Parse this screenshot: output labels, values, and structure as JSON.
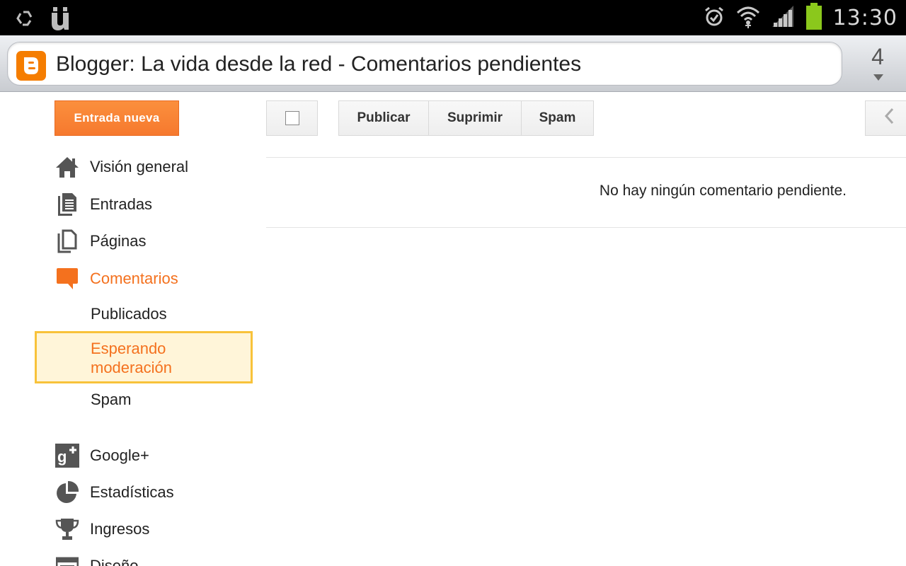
{
  "status_bar": {
    "time": "13:30",
    "icons": [
      "recycle-icon",
      "u-umlaut-app-icon",
      "alarm-icon",
      "wifi-icon",
      "signal-icon",
      "battery-icon"
    ],
    "battery_color": "#8bc81c"
  },
  "browser": {
    "page_title": "Blogger: La vida desde la red - Comentarios pendientes",
    "tab_count": "4",
    "favicon_color": "#f57d00"
  },
  "sidebar": {
    "new_post_label": "Entrada nueva",
    "items": [
      {
        "label": "Visión general",
        "icon": "home-icon"
      },
      {
        "label": "Entradas",
        "icon": "posts-icon"
      },
      {
        "label": "Páginas",
        "icon": "pages-icon"
      },
      {
        "label": "Comentarios",
        "icon": "comment-icon",
        "active": true
      },
      {
        "label": "Google+",
        "icon": "google-plus-icon"
      },
      {
        "label": "Estadísticas",
        "icon": "pie-chart-icon"
      },
      {
        "label": "Ingresos",
        "icon": "trophy-icon"
      },
      {
        "label": "Diseño",
        "icon": "layout-icon"
      }
    ],
    "comment_subitems": [
      "Publicados",
      "Esperando moderación",
      "Spam"
    ],
    "accent_color": "#f4711e",
    "selected_bg": "#fff5d9",
    "selected_border": "#f8c23a"
  },
  "toolbar": {
    "publish_label": "Publicar",
    "delete_label": "Suprimir",
    "spam_label": "Spam"
  },
  "main": {
    "empty_message": "No hay ningún comentario pendiente."
  }
}
